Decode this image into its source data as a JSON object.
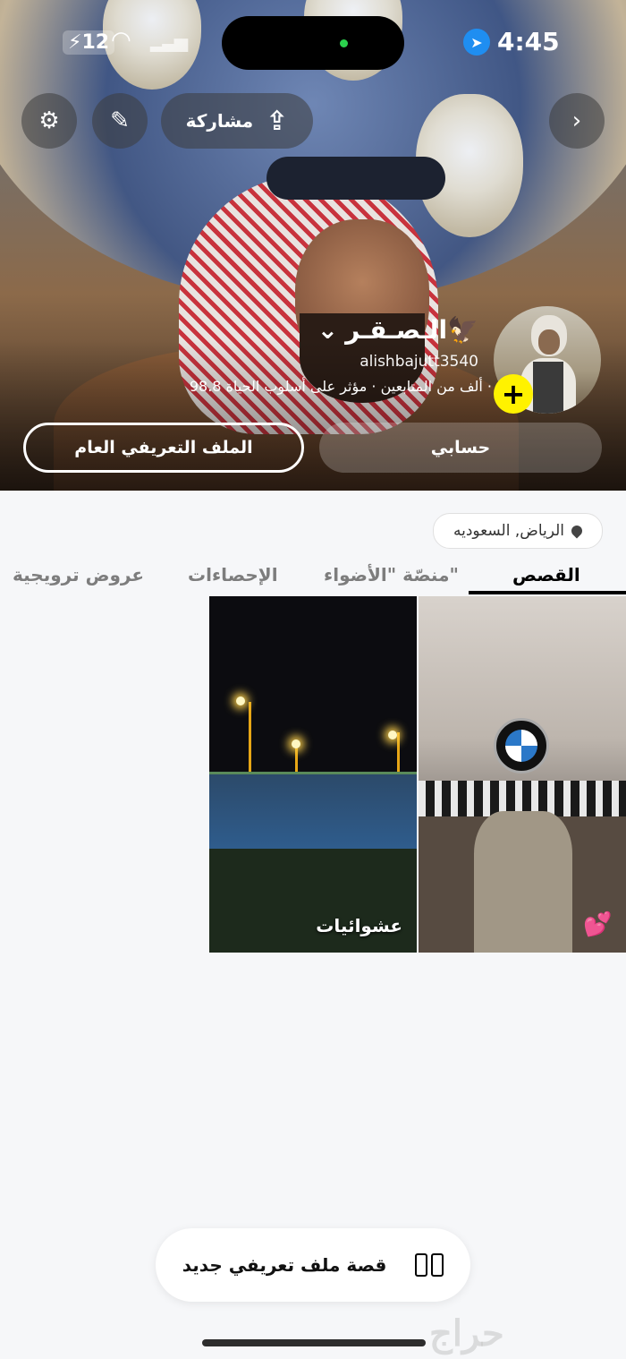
{
  "status_bar": {
    "time": "4:45",
    "battery": "12",
    "icons": [
      "charging-bolt-icon",
      "wifi-icon",
      "cellular-signal-icon",
      "location-arrow-icon"
    ]
  },
  "header": {
    "share_label": "مشاركة",
    "icons": [
      "gear-icon",
      "pencil-icon",
      "upload-icon",
      "chevron-right-icon"
    ]
  },
  "profile": {
    "display_name": "الـصـقـر🦅",
    "username": "alishbajutt3540",
    "meta": "98.8 ألف من المتابعين · مؤثر على أسلوب الحياة ·",
    "public_profile_button": "الملف التعريفي العام",
    "my_account_button": "حسابي",
    "location": "الرياض, السعوديه"
  },
  "tabs": [
    {
      "label": "القصص",
      "active": true
    },
    {
      "label": "منصّة \"الأضواء\"",
      "active": false
    },
    {
      "label": "الإحصاءات",
      "active": false
    },
    {
      "label": "عروض ترويجية",
      "active": false
    }
  ],
  "stories": [
    {
      "caption": "",
      "emoji": "💕"
    },
    {
      "caption": "عشوائيات"
    }
  ],
  "bottom": {
    "new_story_label": "قصة ملف تعريفي جديد"
  },
  "watermark": "حراج",
  "colors": {
    "accent_yellow": "#fff200",
    "location_blue": "#1f8ef1",
    "dynamic_island_dot": "#2bd14d"
  }
}
